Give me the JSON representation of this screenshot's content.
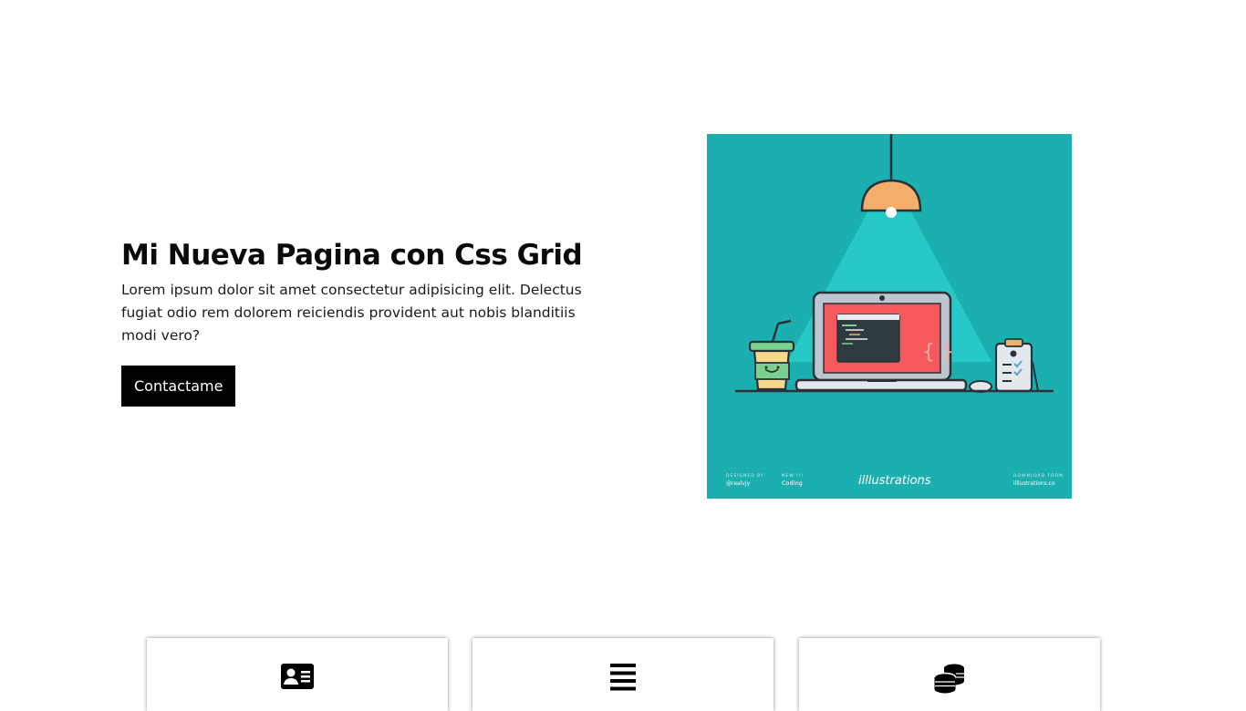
{
  "hero": {
    "title": "Mi Nueva Pagina con Css Grid",
    "description": "Lorem ipsum dolor sit amet consectetur adipisicing elit. Delectus fugiat odio rem dolorem reiciendis provident aut nobis blanditiis modi vero?",
    "cta_label": "Contactame"
  },
  "illustration": {
    "background_color": "#1cafb0",
    "footer": {
      "designed_by_label": "DESIGNED BY",
      "designed_by_value": "@realvjy",
      "category_label": "NEW !!!",
      "category_value": "Coding",
      "brand": "illlustrations",
      "download_label": "DOWNLOAD FROM",
      "download_value": "illlustrations.co"
    }
  },
  "features": [
    {
      "icon": "id-card-icon"
    },
    {
      "icon": "bars-icon"
    },
    {
      "icon": "coins-icon"
    }
  ]
}
